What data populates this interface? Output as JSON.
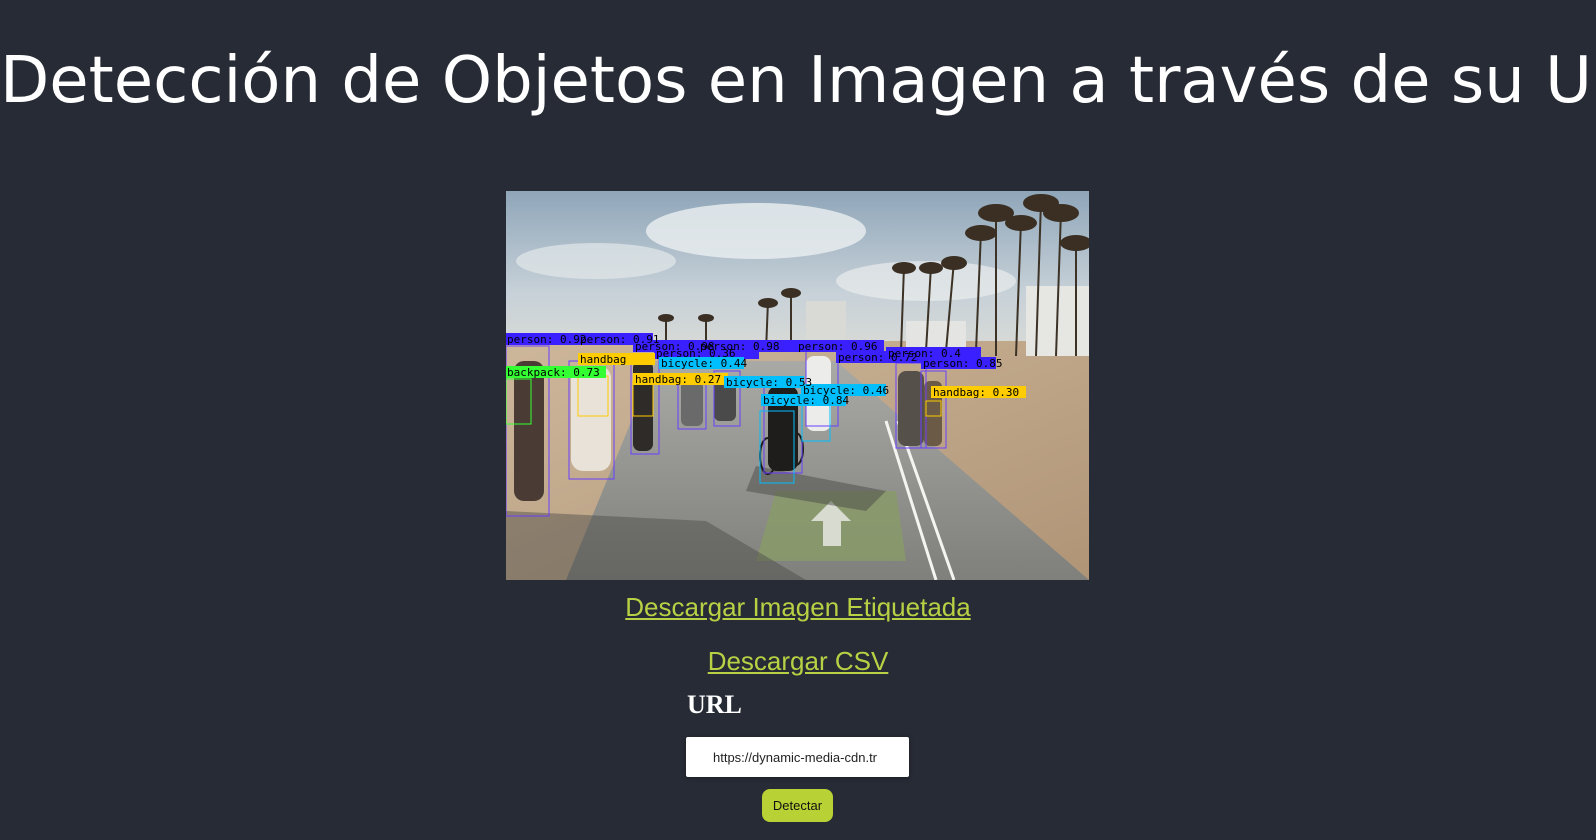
{
  "page": {
    "title": "Detección de Objetos en Imagen a través de su URL"
  },
  "colors": {
    "background": "#272b35",
    "link": "#b8d144",
    "button": "#b8d134",
    "person_box": "#3a1fff",
    "handbag_box": "#ffcc00",
    "bicycle_box": "#00bfff",
    "backpack_box": "#33ff33"
  },
  "detections": [
    {
      "label": "person: 0.92",
      "cls": "person"
    },
    {
      "label": "person: 0.91",
      "cls": "person"
    },
    {
      "label": "person: 0.98",
      "cls": "person"
    },
    {
      "label": "person: 0.98",
      "cls": "person"
    },
    {
      "label": "person: 0.96",
      "cls": "person"
    },
    {
      "label": "person: 0.36",
      "cls": "person"
    },
    {
      "label": "person: 0.72",
      "cls": "person"
    },
    {
      "label": "person: 0.4",
      "cls": "person"
    },
    {
      "label": "person: 0.85",
      "cls": "person"
    },
    {
      "label": "handbag",
      "cls": "handbag"
    },
    {
      "label": "handbag: 0.27",
      "cls": "handbag"
    },
    {
      "label": "handbag: 0.30",
      "cls": "handbag"
    },
    {
      "label": "backpack: 0.73",
      "cls": "backpack"
    },
    {
      "label": "bicycle: 0.44",
      "cls": "bicycle"
    },
    {
      "label": "bicycle: 0.53",
      "cls": "bicycle"
    },
    {
      "label": "bicycle: 0.46",
      "cls": "bicycle"
    },
    {
      "label": "bicycle: 0.84",
      "cls": "bicycle"
    }
  ],
  "links": {
    "download_image": "Descargar Imagen Etiquetada",
    "download_csv": "Descargar CSV"
  },
  "form": {
    "url_label": "URL",
    "url_value": "https://dynamic-media-cdn.tr",
    "detect_label": "Detectar"
  }
}
